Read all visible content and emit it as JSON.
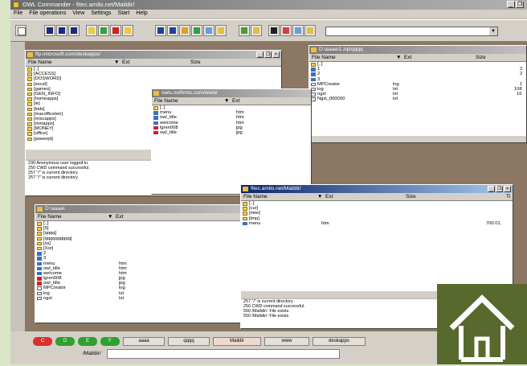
{
  "app": {
    "title": "OWL Commander - fitec.amilo.net/Maildir/",
    "menu": [
      "File",
      "File operations",
      "View",
      "Settings",
      "Start",
      "Help"
    ],
    "window_buttons": [
      "_",
      "❐",
      "×"
    ]
  },
  "windows": {
    "ftp": {
      "title": "ftp.microsoft.com/deskapps/",
      "columns": [
        "File Name",
        "▼",
        "Ext",
        "Size"
      ],
      "rows": [
        "[..]",
        "[ACCESS]",
        "[DOSWORD]",
        "[excel]",
        "[games]",
        "[GEN_INFO]",
        "[homeapps]",
        "[ie]",
        "[kids]",
        "[macofficeten]",
        "[miscapps]",
        "[mmapps]",
        "[MONEY]",
        "[office]",
        "[powerpt]"
      ],
      "log": [
        "230 Anonymous user logged in.",
        "250 CWD command successful.",
        "257 \"/\" is current directory.",
        "257 \"/\" is current directory."
      ]
    },
    "owl": {
      "title": "owls.netfirms.com/www/",
      "columns": [
        "File Name",
        "▼",
        "Ext"
      ],
      "rows": [
        {
          "name": "[..]",
          "ext": ""
        },
        {
          "name": "menu",
          "ext": "htm"
        },
        {
          "name": "owl_title",
          "ext": "htm"
        },
        {
          "name": "welcome",
          "ext": "htm"
        },
        {
          "name": "lgren008",
          "ext": "jpg"
        },
        {
          "name": "owl_title",
          "ext": "jpg"
        }
      ]
    },
    "zip": {
      "title": "D:\\aaaa\\1.zip\\qqqq",
      "columns": [
        "File Name",
        "▼",
        "Ext",
        "Size"
      ],
      "rows": [
        {
          "name": "[..]",
          "ext": "",
          "size": ""
        },
        {
          "name": "1",
          "ext": "",
          "size": "2"
        },
        {
          "name": "2",
          "ext": "",
          "size": "2"
        },
        {
          "name": "3",
          "ext": "",
          "size": ""
        },
        {
          "name": "MPCreator",
          "ext": "log",
          "size": "1"
        },
        {
          "name": "log",
          "ext": "txt",
          "size": "108"
        },
        {
          "name": "ngsl",
          "ext": "txt",
          "size": "16"
        },
        {
          "name": "Ngsl_000000",
          "ext": "txt",
          "size": ""
        }
      ]
    },
    "local": {
      "title": "D:\\aaaa\\",
      "columns": [
        "File Name",
        "▼",
        "Ext"
      ],
      "rows": [
        {
          "name": "[..]",
          "ext": "",
          "t": "folder"
        },
        {
          "name": "[5]",
          "ext": "",
          "t": "folder"
        },
        {
          "name": "[qqqq]",
          "ext": "",
          "t": "folder"
        },
        {
          "name": "[qqqqqqqqqq]",
          "ext": "",
          "t": "folder"
        },
        {
          "name": "[ss]",
          "ext": "",
          "t": "folder"
        },
        {
          "name": "[Xor]",
          "ext": "",
          "t": "folder"
        },
        {
          "name": "2",
          "ext": "",
          "t": "file"
        },
        {
          "name": "3",
          "ext": "",
          "t": "file"
        },
        {
          "name": "menu",
          "ext": "htm",
          "t": "file"
        },
        {
          "name": "owl_title",
          "ext": "htm",
          "t": "file"
        },
        {
          "name": "welcome",
          "ext": "htm",
          "t": "file"
        },
        {
          "name": "lgren008",
          "ext": "jpg",
          "t": "red"
        },
        {
          "name": "owl_title",
          "ext": "jpg",
          "t": "red"
        },
        {
          "name": "MPCreator",
          "ext": "log",
          "t": "txt"
        },
        {
          "name": "log",
          "ext": "txt",
          "t": "txt"
        },
        {
          "name": "ngsl",
          "ext": "txt",
          "t": "txt"
        }
      ]
    },
    "maildir": {
      "title": "fitec.amilo.net/Maildir/",
      "columns": [
        "File Name",
        "▼",
        "Ext",
        "Size",
        "Ti"
      ],
      "rows": [
        {
          "name": "[..]",
          "ext": "",
          "size": ""
        },
        {
          "name": "[cur]",
          "ext": "",
          "size": ""
        },
        {
          "name": "[new]",
          "ext": "",
          "size": ""
        },
        {
          "name": "[tmp]",
          "ext": "",
          "size": ""
        },
        {
          "name": "menu",
          "ext": "htm",
          "size": "700  01."
        }
      ],
      "log": [
        "257 \"/\" is current directory.",
        "250 CWD command successful.",
        "550 /Maildir/: File exists",
        "550 /Maildir/: File exists"
      ]
    }
  },
  "bottom": {
    "drives": [
      {
        "label": "C",
        "color": "#d83030"
      },
      {
        "label": "D",
        "color": "#30a030"
      },
      {
        "label": "E",
        "color": "#30a030"
      },
      {
        "label": "F",
        "color": "#30a030"
      }
    ],
    "tabs": [
      "aaaa",
      "qqqq",
      "Maildir",
      "www",
      "deskapps"
    ],
    "path_label": "/Maildir/"
  }
}
